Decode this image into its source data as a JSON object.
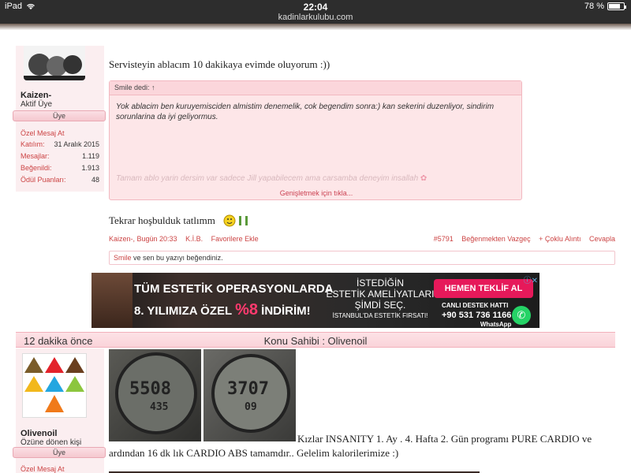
{
  "status_bar": {
    "device": "iPad",
    "time": "22:04",
    "url": "kadinlarkulubu.com",
    "battery": "78 %",
    "battery_level": 78
  },
  "post1": {
    "user": {
      "name": "Kaizen-",
      "title": "Aktif Üye",
      "badge": "Üye",
      "private_msg": "Özel Mesaj At",
      "stats": [
        {
          "label": "Katılım:",
          "value": "31 Aralık 2015"
        },
        {
          "label": "Mesajlar:",
          "value": "1.119"
        },
        {
          "label": "Beğenildi:",
          "value": "1.913"
        },
        {
          "label": "Ödül Puanları:",
          "value": "48"
        }
      ]
    },
    "text_top": "Servisteyin ablacım 10 dakikaya evimde oluyorum :))",
    "quote": {
      "header": "Smile dedi: ↑",
      "body": "Yok ablacim ben kuruyemisciden almistim denemelik, cok begendim sonra:) kan sekerini duzenliyor, sindirim sorunlarina da iyi geliyormus.",
      "faded": "Tamam ablo yarin dersim var sadece Jill yapabilecem ama carsamba deneyim insallah",
      "expand": "Genişletmek için tıkla..."
    },
    "reply": "Tekrar hoşbulduk tatlımm",
    "meta": {
      "author_time": "Kaizen-, Bugün 20:33",
      "kib": "K.İ.B.",
      "fav": "Favorilere Ekle",
      "post_no": "#5791",
      "unlike": "Beğenmekten Vazgeç",
      "multi_quote": "+ Çoklu Alıntı",
      "reply": "Cevapla"
    },
    "likes": {
      "user": "Smile",
      "text": " ve sen bu yazıyı beğendiniz."
    }
  },
  "ad": {
    "line1": "TÜM ESTETİK OPERASYONLARDA",
    "line2a": "8. YILIMIZA ÖZEL ",
    "line2b": "%8",
    "line2c": " İNDİRİM!",
    "mid1": "İSTEDİĞİN",
    "mid2": "ESTETİK AMELİYATLARI",
    "mid3": "ŞİMDİ SEÇ.",
    "mid4": "İSTANBUL'DA ESTETİK FIRSATI!",
    "cta": "HEMEN TEKLİF AL",
    "hotline": "CANLI DESTEK HATTI",
    "phone": "+90 531 736 1166",
    "wa_label": "WhatsApp"
  },
  "post2": {
    "time_ago": "12 dakika önce",
    "starter": "Konu Sahibi : Olivenoil",
    "user": {
      "name": "Olivenoil",
      "title": "Özüne dönen kişi",
      "badge": "Üye",
      "private_msg": "Özel Mesaj At"
    },
    "watch1": {
      "top": "5508",
      "bottom": "435"
    },
    "watch2": {
      "top": "3707",
      "bottom": "09"
    },
    "text": "Kızlar INSANITY 1. Ay . 4. Hafta 2. Gün programı PURE CARDIO ve ardından 16 dk lık CARDIO ABS tamamdır.. Gelelim kalorilerimize :)"
  }
}
